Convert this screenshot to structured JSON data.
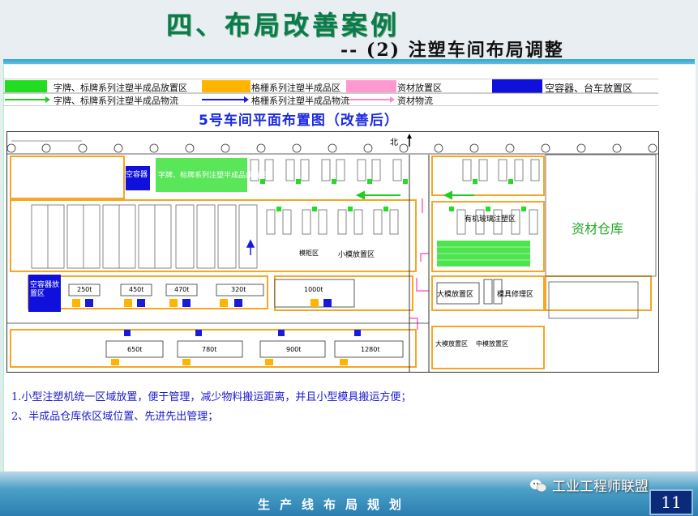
{
  "title": {
    "main": "四、布局改善案例",
    "sub": "-- (2) 注塑车间布局调整"
  },
  "legend": {
    "green_area": "字牌、标牌系列注塑半成品放置区",
    "orange_area": "格栅系列注塑半成品区",
    "pink_area": "资材放置区",
    "blue_area": "空容器、台车放置区",
    "green_flow": "字牌、标牌系列注塑半成品物流",
    "blue_flow": "格栅系列注塑半成品物流",
    "pink_flow": "资材物流"
  },
  "plan": {
    "heading": "5号车间平面布置图（改善后）",
    "north": "北",
    "labels": {
      "green_top": "字牌、标牌系列注塑半成品放置区",
      "blue_top": "空容器",
      "small_mold": "小模放置区",
      "cabinet": "模柜区",
      "material_warehouse": "资材仓库",
      "organic_semi": "有机玻璃注塑区",
      "large_mold": "大模放置区",
      "mold_repair": "模具修理区",
      "large_mold_2": "大模放置区",
      "mid_mold": "中模放置区",
      "blue_left": "空容器放置区"
    },
    "machines": {
      "m250": "250t",
      "m450": "450t",
      "m470": "470t",
      "m320": "320t",
      "m1000": "1000t",
      "m650": "650t",
      "m780": "780t",
      "m900": "900t",
      "m1280": "1280t"
    }
  },
  "notes": [
    "1.小型注塑机统一区域放置，便于管理，减少物料搬运距离，并且小型模具搬运方便；",
    "2、半成品仓库依区域位置、先进先出管理；"
  ],
  "footer": {
    "title": "生产线布局规划",
    "watermark": "工业工程师联盟",
    "page": "11"
  },
  "colors": {
    "green_area": "#22dd22",
    "orange_area": "#ffb400",
    "pink_area": "#ff9ad0",
    "blue_area": "#1010dd"
  }
}
